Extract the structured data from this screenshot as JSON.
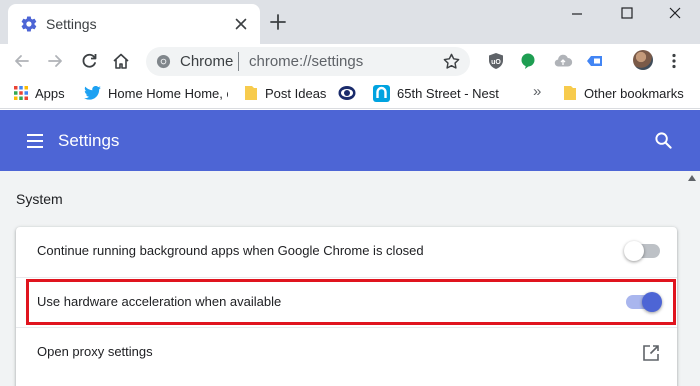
{
  "tab": {
    "title": "Settings"
  },
  "omnibox": {
    "host": "Chrome",
    "url": "chrome://settings"
  },
  "bookmarks": [
    {
      "label": "Apps",
      "icon": "apps-grid-icon"
    },
    {
      "label": "Home Home Home, c",
      "icon": "twitter-bird-icon"
    },
    {
      "label": "Post Ideas",
      "icon": "folder-icon"
    },
    {
      "label": "",
      "icon": "eye-logo-icon"
    },
    {
      "label": "65th Street - Nest",
      "icon": "nest-logo-icon"
    },
    {
      "label": "Other bookmarks",
      "icon": "folder-icon"
    }
  ],
  "bookmarks_overflow": "»",
  "header": {
    "title": "Settings"
  },
  "section": {
    "title": "System"
  },
  "rows": [
    {
      "label": "Continue running background apps when Google Chrome is closed",
      "toggle": "off"
    },
    {
      "label": "Use hardware acceleration when available",
      "toggle": "on"
    },
    {
      "label": "Open proxy settings",
      "action": "external-link-icon"
    }
  ],
  "colors": {
    "header": "#4d65d5",
    "highlight": "#e0141e",
    "toggle_on": "#4d65d5"
  }
}
